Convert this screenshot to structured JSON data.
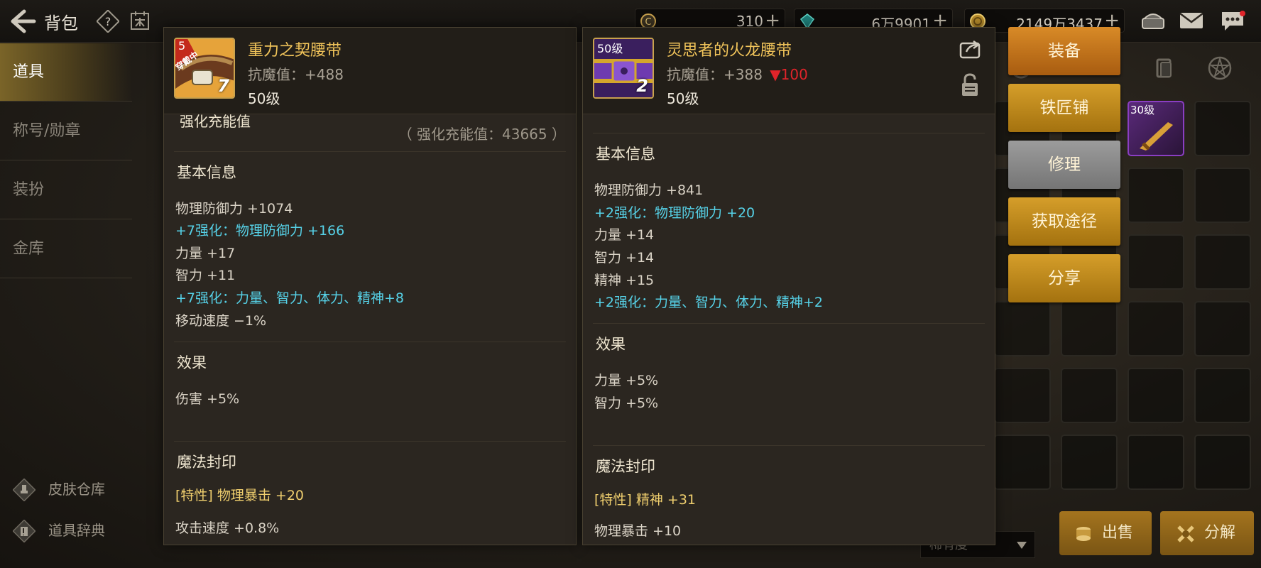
{
  "topbar": {
    "title": "背包",
    "currency": [
      {
        "icon": "coin-c-icon",
        "value": "310"
      },
      {
        "icon": "crystal-icon",
        "value": "6万9901"
      },
      {
        "icon": "gold-coin-icon",
        "value": "2149万3437"
      }
    ],
    "plus": "+"
  },
  "sidebar": {
    "tabs": [
      "道具",
      "称号/勋章",
      "装扮",
      "金库"
    ],
    "bottom_links": [
      {
        "icon": "brush-icon",
        "label": "皮肤仓库"
      },
      {
        "icon": "book-icon",
        "label": "道具辞典"
      }
    ]
  },
  "left_panel": {
    "name": "重力之契腰带",
    "resist": "抗魔值：+488",
    "level": "50级",
    "icon_badge": "5",
    "icon_tag": "穿戴中",
    "enhance": "7",
    "charge_header": "强化充能值",
    "charge_value": "（ 强化充能值：43665 ）",
    "basic_title": "基本信息",
    "basic": [
      {
        "text": "物理防御力 +1074",
        "color": "white"
      },
      {
        "text": "+7强化：物理防御力 +166",
        "color": "cyan"
      },
      {
        "text": "力量 +17",
        "color": "white"
      },
      {
        "text": "智力 +11",
        "color": "white"
      },
      {
        "text": "+7强化：力量、智力、体力、精神+8",
        "color": "cyan"
      },
      {
        "text": "移动速度 −1%",
        "color": "white"
      }
    ],
    "effect_title": "效果",
    "effects": [
      "伤害 +5%"
    ],
    "seal_title": "魔法封印",
    "seal": [
      {
        "text": "[特性] 物理暴击 +20",
        "color": "gold"
      },
      {
        "text": "攻击速度 +0.8%",
        "color": "white"
      }
    ]
  },
  "right_panel": {
    "name": "灵思者的火龙腰带",
    "resist": "抗魔值：+388",
    "resist_diff": "▼100",
    "level": "50级",
    "icon_level": "50级",
    "enhance": "2",
    "basic_title": "基本信息",
    "basic": [
      {
        "text": "物理防御力 +841",
        "color": "white"
      },
      {
        "text": "+2强化：物理防御力 +20",
        "color": "cyan"
      },
      {
        "text": "力量 +14",
        "color": "white"
      },
      {
        "text": "智力 +14",
        "color": "white"
      },
      {
        "text": "精神 +15",
        "color": "white"
      },
      {
        "text": "+2强化：力量、智力、体力、精神+2",
        "color": "cyan"
      }
    ],
    "effect_title": "效果",
    "effects": [
      "力量 +5%",
      "智力 +5%"
    ],
    "seal_title": "魔法封印",
    "seal": [
      {
        "text": "[特性] 精神 +31",
        "color": "gold"
      },
      {
        "text": "物理暴击 +10",
        "color": "white"
      }
    ]
  },
  "actions": [
    "装备",
    "铁匠铺",
    "修理",
    "获取途径",
    "分享"
  ],
  "inventory": {
    "slot_level": "30级",
    "sell_label": "出售",
    "decompose_label": "分解",
    "rarity_label": "稀有度"
  },
  "colors": {
    "accent_gold": "#f1c45a",
    "cyan": "#56d2e8",
    "red": "#e0242a"
  }
}
